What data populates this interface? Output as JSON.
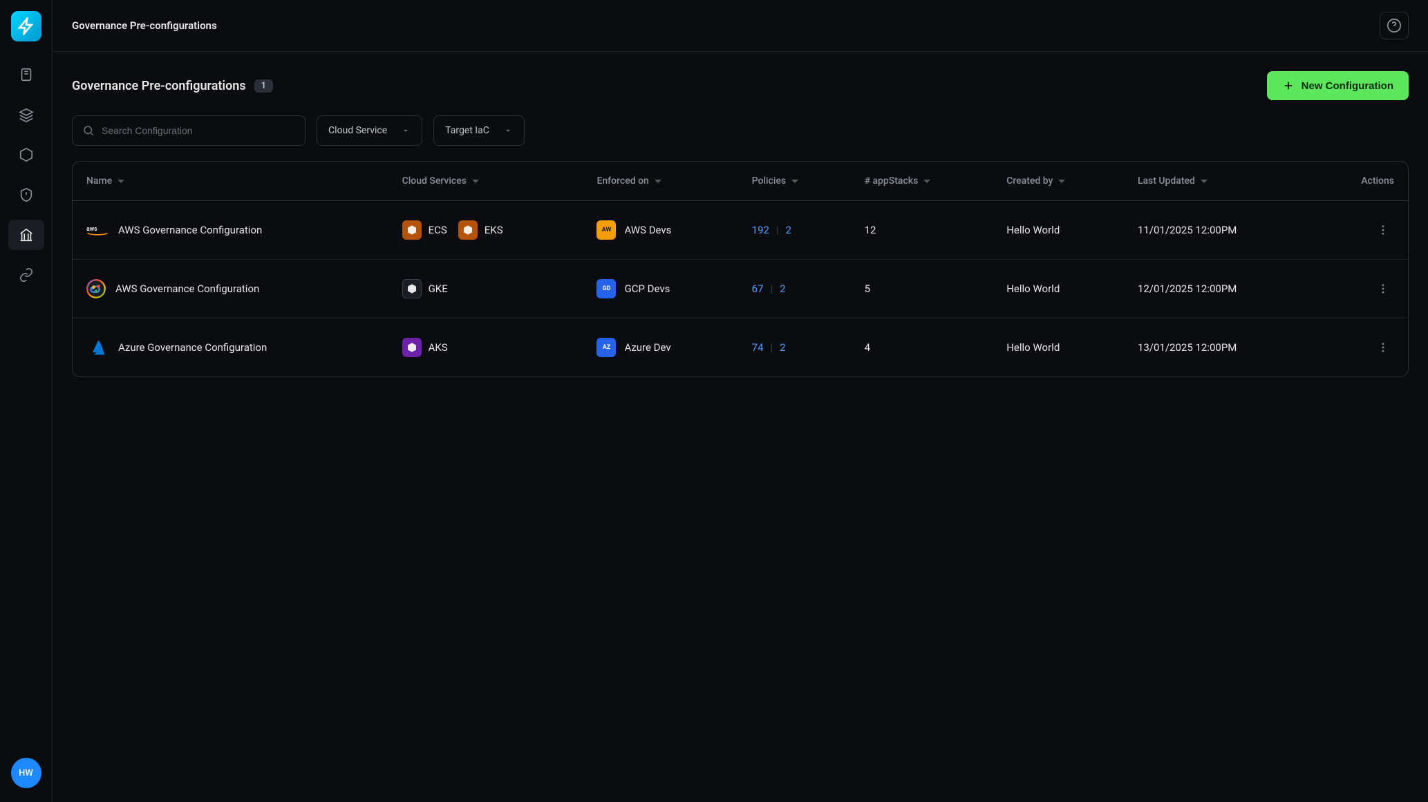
{
  "header": {
    "breadcrumb": "Governance Pre-configurations"
  },
  "page": {
    "title": "Governance Pre-configurations",
    "count": "1",
    "new_button": "New Configuration"
  },
  "filters": {
    "search_placeholder": "Search Configuration",
    "cloud_service_label": "Cloud Service",
    "target_iac_label": "Target IaC"
  },
  "sidebar": {
    "user_initials": "HW"
  },
  "table": {
    "headers": {
      "name": "Name",
      "cloud_services": "Cloud Services",
      "enforced_on": "Enforced on",
      "policies": "Policies",
      "appstacks": "# appStacks",
      "created_by": "Created by",
      "last_updated": "Last Updated",
      "actions": "Actions"
    },
    "rows": [
      {
        "cloud": "aws",
        "name": "AWS Governance Configuration",
        "services": [
          {
            "icon": "ecs",
            "label": "ECS"
          },
          {
            "icon": "eks",
            "label": "EKS"
          }
        ],
        "enforced": {
          "badge": "AW",
          "badge_class": "aws",
          "label": "AWS Devs"
        },
        "policies": {
          "a": "192",
          "b": "2"
        },
        "appstacks": "12",
        "created_by": "Hello World",
        "last_updated": "11/01/2025 12:00PM"
      },
      {
        "cloud": "gcp",
        "name": "AWS Governance Configuration",
        "services": [
          {
            "icon": "gke",
            "label": "GKE"
          }
        ],
        "enforced": {
          "badge": "GD",
          "badge_class": "gcp",
          "label": "GCP Devs"
        },
        "policies": {
          "a": "67",
          "b": "2"
        },
        "appstacks": "5",
        "created_by": "Hello World",
        "last_updated": "12/01/2025 12:00PM"
      },
      {
        "cloud": "azure",
        "name": "Azure Governance Configuration",
        "services": [
          {
            "icon": "aks",
            "label": "AKS"
          }
        ],
        "enforced": {
          "badge": "AZ",
          "badge_class": "azure",
          "label": "Azure Dev"
        },
        "policies": {
          "a": "74",
          "b": "2"
        },
        "appstacks": "4",
        "created_by": "Hello World",
        "last_updated": "13/01/2025 12:00PM"
      }
    ]
  }
}
